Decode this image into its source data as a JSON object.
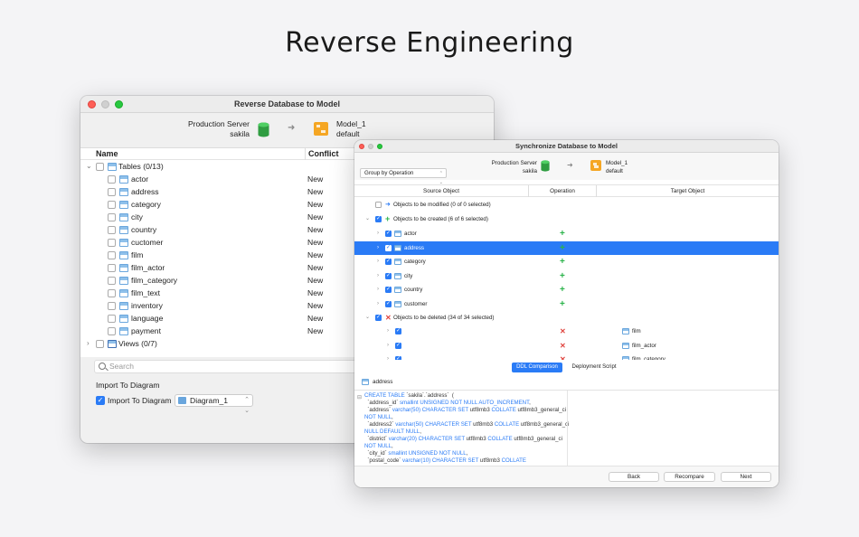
{
  "headline": "Reverse Engineering",
  "reverse_window": {
    "title": "Reverse Database to Model",
    "source": {
      "server": "Production Server",
      "database": "sakila"
    },
    "target": {
      "model": "Model_1",
      "schema": "default"
    },
    "columns": {
      "name": "Name",
      "conflict": "Conflict"
    },
    "tables_group": "Tables (0/13)",
    "tables": [
      {
        "name": "actor",
        "conflict": "New"
      },
      {
        "name": "address",
        "conflict": "New"
      },
      {
        "name": "category",
        "conflict": "New"
      },
      {
        "name": "city",
        "conflict": "New"
      },
      {
        "name": "country",
        "conflict": "New"
      },
      {
        "name": "cuctomer",
        "conflict": "New"
      },
      {
        "name": "film",
        "conflict": "New"
      },
      {
        "name": "film_actor",
        "conflict": "New"
      },
      {
        "name": "film_category",
        "conflict": "New"
      },
      {
        "name": "film_text",
        "conflict": "New"
      },
      {
        "name": "inventory",
        "conflict": "New"
      },
      {
        "name": "language",
        "conflict": "New"
      },
      {
        "name": "payment",
        "conflict": "New"
      }
    ],
    "views_group": "Views (0/7)",
    "search_placeholder": "Search",
    "import_label": "Import To Diagram",
    "import_checkbox": "Import To Diagram",
    "import_checked": true,
    "diagram_select": "Diagram_1"
  },
  "sync_window": {
    "title": "Synchronize Database to Model",
    "source": {
      "server": "Production Server",
      "database": "sakila"
    },
    "target": {
      "model": "Model_1",
      "schema": "default"
    },
    "group_by": "Group by Operation",
    "columns": {
      "source": "Source Object",
      "operation": "Operation",
      "target": "Target Object"
    },
    "modified_group": "Objects to be modified (0 of 0 selected)",
    "created_group": "Objects to be created (6 of 6 selected)",
    "created_items": [
      "actor",
      "address",
      "category",
      "city",
      "country",
      "customer"
    ],
    "selected_item": "address",
    "deleted_group": "Objects to be deleted (34 of 34 selected)",
    "deleted_items": [
      "film",
      "film_actor",
      "film_category"
    ],
    "tabs": {
      "ddl": "DDL Comparison",
      "script": "Deployment Script"
    },
    "ddl_object": "address",
    "ddl_lines": [
      "CREATE TABLE `sakila`.`address`  (",
      "  `address_id` smallint UNSIGNED NOT NULL AUTO_INCREMENT,",
      "  `address` varchar(50) CHARACTER SET utf8mb3 COLLATE utf8mb3_general_ci",
      "NOT NULL,",
      "  `address2` varchar(50) CHARACTER SET utf8mb3 COLLATE utf8mb3_general_ci",
      "NULL DEFAULT NULL,",
      "  `district` varchar(20) CHARACTER SET utf8mb3 COLLATE utf8mb3_general_ci",
      "NOT NULL,",
      "  `city_id` smallint UNSIGNED NOT NULL,",
      "  `postal_code` varchar(10) CHARACTER SET utf8mb3 COLLATE"
    ],
    "buttons": {
      "back": "Back",
      "recompare": "Recompare",
      "next": "Next"
    },
    "colors": {
      "accent": "#2a7bf6",
      "create": "#2ab34a",
      "delete": "#e0443e"
    }
  }
}
